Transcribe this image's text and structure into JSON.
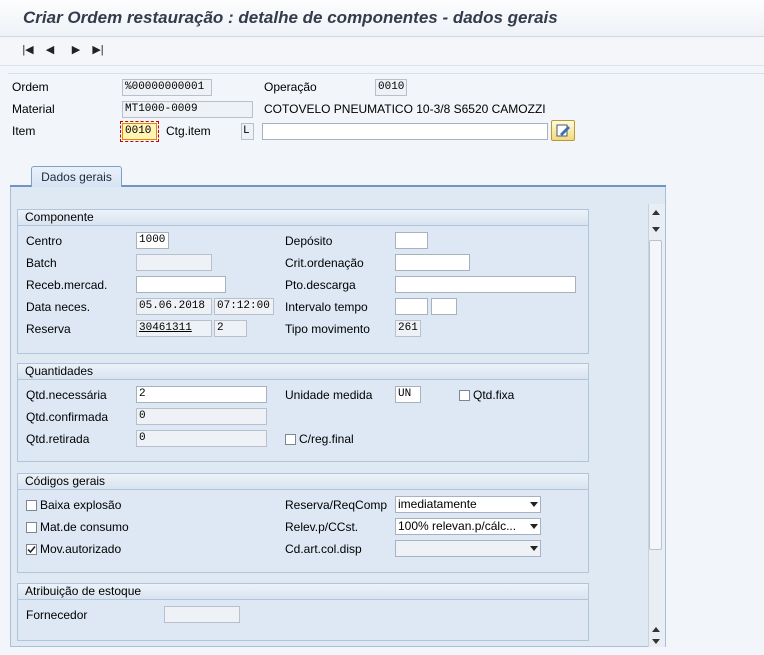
{
  "window": {
    "title": "Criar Ordem restauração : detalhe de componentes - dados gerais"
  },
  "toolbar": {
    "first": "first-page-icon",
    "prev": "previous-page-icon",
    "next": "next-page-icon",
    "last": "last-page-icon"
  },
  "header": {
    "ordem_label": "Ordem",
    "ordem_value": "%00000000001",
    "operacao_label": "Operação",
    "operacao_value": "0010",
    "material_label": "Material",
    "material_value": "MT1000-0009",
    "material_desc": "COTOVELO PNEUMATICO 10-3/8 S6520 CAMOZZI",
    "item_label": "Item",
    "item_value": "0010",
    "ctg_label": "Ctg.item",
    "ctg_value": "L",
    "text_value": ""
  },
  "tabs": [
    {
      "label": "Dados gerais",
      "active": true
    }
  ],
  "componente": {
    "title": "Componente",
    "centro_label": "Centro",
    "centro_value": "1000",
    "deposito_label": "Depósito",
    "deposito_value": "",
    "batch_label": "Batch",
    "batch_value": "",
    "crit_label": "Crit.ordenação",
    "crit_value": "",
    "receb_label": "Receb.mercad.",
    "receb_value": "",
    "pto_label": "Pto.descarga",
    "pto_value": "",
    "data_label": "Data neces.",
    "data_value": "05.06.2018",
    "hora_value": "07:12:00",
    "intervalo_label": "Intervalo tempo",
    "intervalo_value1": "",
    "intervalo_value2": "",
    "reserva_label": "Reserva",
    "reserva_value": "30461311",
    "reserva_item": "2",
    "tipo_label": "Tipo movimento",
    "tipo_value": "261"
  },
  "quantidades": {
    "title": "Quantidades",
    "qtd_nec_label": "Qtd.necessária",
    "qtd_nec_value": "2",
    "unidade_label": "Unidade medida",
    "unidade_value": "UN",
    "qtd_fixa_label": "Qtd.fixa",
    "qtd_fixa_checked": false,
    "qtd_conf_label": "Qtd.confirmada",
    "qtd_conf_value": "0",
    "qtd_ret_label": "Qtd.retirada",
    "qtd_ret_value": "0",
    "creg_label": "C/reg.final",
    "creg_checked": false
  },
  "codigos": {
    "title": "Códigos gerais",
    "baixa_label": "Baixa explosão",
    "baixa_checked": false,
    "mat_label": "Mat.de consumo",
    "mat_checked": false,
    "mov_label": "Mov.autorizado",
    "mov_checked": true,
    "reserva_req_label": "Reserva/ReqComp",
    "reserva_req_value": "imediatamente",
    "relev_label": "Relev.p/CCst.",
    "relev_value": "100% relevan.p/cálc...",
    "cdart_label": "Cd.art.col.disp",
    "cdart_value": ""
  },
  "atribuicao": {
    "title": "Atribuição de estoque",
    "fornecedor_label": "Fornecedor",
    "fornecedor_value": ""
  }
}
